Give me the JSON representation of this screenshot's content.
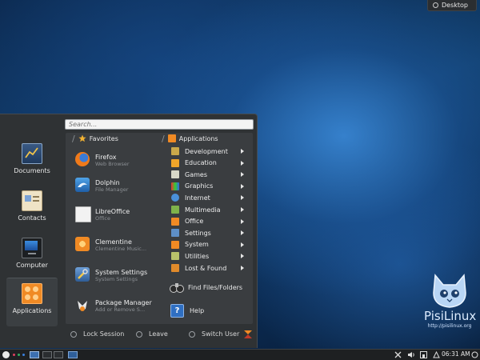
{
  "desktop": {
    "button_label": "Desktop",
    "logo": {
      "name": "PisiLinux",
      "url": "http://pisilinux.org"
    },
    "colors": {
      "accent": "#2a6bbf",
      "launcher_bg": "#2f3234"
    }
  },
  "launcher": {
    "search_placeholder": "Search...",
    "sidebar": [
      {
        "label": "Documents",
        "icon": "documents-icon"
      },
      {
        "label": "Contacts",
        "icon": "contacts-icon"
      },
      {
        "label": "Computer",
        "icon": "computer-icon"
      },
      {
        "label": "Applications",
        "icon": "applications-icon",
        "active": true
      }
    ],
    "favorites": {
      "heading": "Favorites",
      "items": [
        {
          "name": "Firefox",
          "desc": "Web Browser",
          "icon": "firefox-icon"
        },
        {
          "name": "Dolphin",
          "desc": "File Manager",
          "icon": "dolphin-icon"
        },
        {
          "name": "LibreOffice",
          "desc": "Office",
          "icon": "libreoffice-icon"
        },
        {
          "name": "Clementine",
          "desc": "Clementine Music...",
          "icon": "clementine-icon"
        },
        {
          "name": "System Settings",
          "desc": "System Settings",
          "icon": "system-settings-icon"
        },
        {
          "name": "Package Manager",
          "desc": "Add or Remove S...",
          "icon": "package-manager-icon"
        }
      ]
    },
    "applications": {
      "heading": "Applications",
      "items": [
        {
          "name": "Development"
        },
        {
          "name": "Education"
        },
        {
          "name": "Games"
        },
        {
          "name": "Graphics"
        },
        {
          "name": "Internet"
        },
        {
          "name": "Multimedia"
        },
        {
          "name": "Office"
        },
        {
          "name": "Settings"
        },
        {
          "name": "System"
        },
        {
          "name": "Utilities"
        },
        {
          "name": "Lost & Found"
        }
      ],
      "find_label": "Find Files/Folders",
      "help_label": "Help"
    },
    "actions": {
      "lock": "Lock Session",
      "leave": "Leave",
      "switch": "Switch User"
    }
  },
  "taskbar": {
    "clock": "06:31 AM"
  }
}
